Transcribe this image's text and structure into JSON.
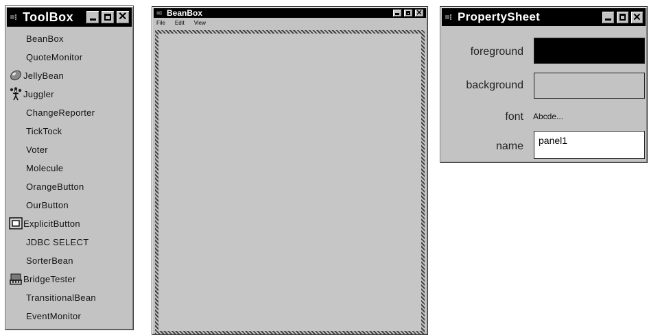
{
  "toolbox": {
    "title": "ToolBox",
    "controls": {
      "minimize": "_",
      "maximize": "□",
      "close": "✕"
    },
    "items": [
      {
        "label": "BeanBox",
        "icon": ""
      },
      {
        "label": "QuoteMonitor",
        "icon": ""
      },
      {
        "label": "JellyBean",
        "icon": "jellybean-icon"
      },
      {
        "label": "Juggler",
        "icon": "juggler-icon"
      },
      {
        "label": "ChangeReporter",
        "icon": ""
      },
      {
        "label": "TickTock",
        "icon": ""
      },
      {
        "label": "Voter",
        "icon": ""
      },
      {
        "label": "Molecule",
        "icon": ""
      },
      {
        "label": "OrangeButton",
        "icon": ""
      },
      {
        "label": "OurButton",
        "icon": ""
      },
      {
        "label": "ExplicitButton",
        "icon": "explicit-button-icon"
      },
      {
        "label": "JDBC SELECT",
        "icon": ""
      },
      {
        "label": "SorterBean",
        "icon": ""
      },
      {
        "label": "BridgeTester",
        "icon": "bridge-tester-icon"
      },
      {
        "label": "TransitionalBean",
        "icon": ""
      },
      {
        "label": "EventMonitor",
        "icon": ""
      }
    ]
  },
  "beanbox": {
    "title": "BeanBox",
    "controls": {
      "minimize": "_",
      "maximize": "□",
      "close": "✕"
    },
    "menu": [
      "File",
      "Edit",
      "View"
    ]
  },
  "propertysheet": {
    "title": "PropertySheet",
    "controls": {
      "minimize": "_",
      "maximize": "□",
      "close": "✕"
    },
    "properties": {
      "foreground": {
        "label": "foreground",
        "color": "#000000"
      },
      "background": {
        "label": "background",
        "color": "#c3c3c3"
      },
      "font": {
        "label": "font",
        "value": "Abcde..."
      },
      "name": {
        "label": "name",
        "value": "panel1"
      }
    }
  }
}
